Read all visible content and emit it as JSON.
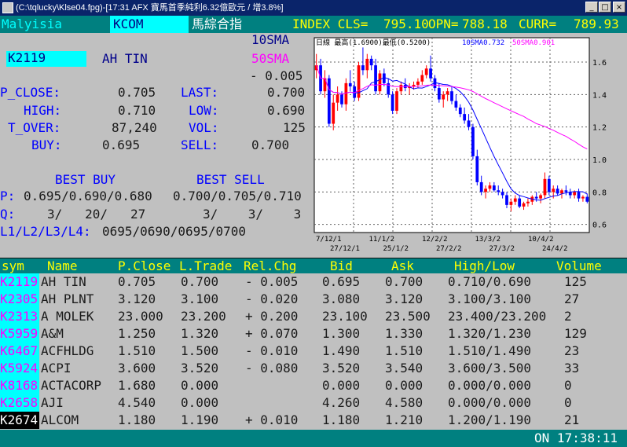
{
  "window": {
    "title": "(C:\\tqlucky\\Klse04.fpg)-[17:31 AFX  寶馬首季純利6.32億歐元 / 增3.8%]",
    "buttons": [
      "_",
      "□",
      "×"
    ]
  },
  "header": {
    "market": "Malyisia",
    "code": "KCOM",
    "index_name": "馬綜合指",
    "index_cls_label": "INDEX CLS=",
    "index_cls": "795.10",
    "opn_label": "OPN=",
    "opn": "788.18",
    "curr_label": "CURR=",
    "curr": "789.93"
  },
  "quote": {
    "sma10_label": "10SMA",
    "code": "K2119",
    "name": "AH TIN",
    "sma50_label": "50SMA",
    "change": "- 0.005",
    "p_close_label": "P_CLOSE:",
    "p_close": "0.705",
    "last_label": "LAST:",
    "last": "0.700",
    "high_label": "HIGH:",
    "high": "0.710",
    "low_label": "LOW:",
    "low": "0.690",
    "t_over_label": "T_OVER:",
    "t_over": "87,240",
    "vol_label": "VOL:",
    "vol": "125",
    "buy_label": "BUY:",
    "buy": "0.695",
    "sell_label": "SELL:",
    "sell": "0.700",
    "best_buy_label": "BEST BUY",
    "best_sell_label": "BEST SELL",
    "p_label": "P:",
    "best_buy_prices": "0.695/0.690/0.680",
    "best_sell_prices": "0.700/0.705/0.710",
    "q_label": "Q:",
    "best_buy_qty": "3/   20/   27",
    "best_sell_qty": "3/    3/    3",
    "levels_label": "L1/L2/L3/L4:",
    "levels": "0695/0690/0695/0700"
  },
  "chart_data": {
    "type": "candlestick",
    "legend_text": "日線 最高(1.6900)最低(0.5200)",
    "sma10_text": "10SMA0.732",
    "sma50_text": "50SMA0.901",
    "ylim": [
      0.55,
      1.75
    ],
    "y_ticks": [
      "1.6",
      "1.4",
      "1.2",
      "1.0",
      "0.8",
      "0.6"
    ],
    "y_tick_values": [
      1.6,
      1.4,
      1.2,
      1.0,
      0.8,
      0.6
    ],
    "x_labels_top": [
      "7/12/1",
      "11/1/2",
      "12/2/2",
      "13/3/2",
      "10/4/2"
    ],
    "x_labels_bottom": [
      "27/12/1",
      "25/1/2",
      "27/2/2",
      "27/3/2",
      "24/4/2"
    ],
    "grid": true,
    "candles": [
      [
        1.55,
        1.65,
        1.5,
        1.58
      ],
      [
        1.58,
        1.62,
        1.4,
        1.42
      ],
      [
        1.42,
        1.55,
        1.38,
        1.5
      ],
      [
        1.5,
        1.52,
        1.2,
        1.22
      ],
      [
        1.22,
        1.4,
        1.18,
        1.35
      ],
      [
        1.35,
        1.45,
        1.3,
        1.4
      ],
      [
        1.4,
        1.42,
        1.32,
        1.34
      ],
      [
        1.34,
        1.5,
        1.3,
        1.47
      ],
      [
        1.47,
        1.55,
        1.42,
        1.45
      ],
      [
        1.45,
        1.48,
        1.36,
        1.38
      ],
      [
        1.38,
        1.6,
        1.36,
        1.58
      ],
      [
        1.58,
        1.69,
        1.52,
        1.55
      ],
      [
        1.55,
        1.65,
        1.5,
        1.62
      ],
      [
        1.62,
        1.64,
        1.55,
        1.58
      ],
      [
        1.58,
        1.62,
        1.4,
        1.42
      ],
      [
        1.42,
        1.55,
        1.4,
        1.53
      ],
      [
        1.53,
        1.56,
        1.45,
        1.47
      ],
      [
        1.47,
        1.5,
        1.38,
        1.4
      ],
      [
        1.4,
        1.42,
        1.28,
        1.3
      ],
      [
        1.3,
        1.44,
        1.28,
        1.42
      ],
      [
        1.42,
        1.48,
        1.4,
        1.46
      ],
      [
        1.46,
        1.5,
        1.42,
        1.44
      ],
      [
        1.44,
        1.47,
        1.4,
        1.45
      ],
      [
        1.45,
        1.48,
        1.43,
        1.46
      ],
      [
        1.46,
        1.5,
        1.44,
        1.48
      ],
      [
        1.48,
        1.55,
        1.46,
        1.52
      ],
      [
        1.52,
        1.58,
        1.5,
        1.56
      ],
      [
        1.56,
        1.64,
        1.48,
        1.5
      ],
      [
        1.5,
        1.52,
        1.42,
        1.44
      ],
      [
        1.44,
        1.47,
        1.35,
        1.37
      ],
      [
        1.37,
        1.42,
        1.32,
        1.4
      ],
      [
        1.4,
        1.44,
        1.36,
        1.42
      ],
      [
        1.42,
        1.45,
        1.34,
        1.36
      ],
      [
        1.36,
        1.4,
        1.3,
        1.32
      ],
      [
        1.32,
        1.34,
        1.26,
        1.28
      ],
      [
        1.28,
        1.32,
        1.22,
        1.24
      ],
      [
        1.24,
        1.28,
        1.18,
        1.2
      ],
      [
        1.2,
        1.22,
        1.0,
        1.02
      ],
      [
        1.02,
        1.06,
        0.84,
        0.86
      ],
      [
        0.86,
        0.9,
        0.78,
        0.8
      ],
      [
        0.8,
        0.84,
        0.76,
        0.82
      ],
      [
        0.82,
        0.86,
        0.8,
        0.84
      ],
      [
        0.84,
        0.86,
        0.8,
        0.81
      ],
      [
        0.81,
        0.84,
        0.78,
        0.8
      ],
      [
        0.8,
        0.82,
        0.76,
        0.78
      ],
      [
        0.78,
        0.8,
        0.7,
        0.72
      ],
      [
        0.72,
        0.76,
        0.68,
        0.74
      ],
      [
        0.74,
        0.78,
        0.72,
        0.76
      ],
      [
        0.76,
        0.78,
        0.7,
        0.71
      ],
      [
        0.71,
        0.74,
        0.69,
        0.73
      ],
      [
        0.73,
        0.76,
        0.71,
        0.74
      ],
      [
        0.74,
        0.78,
        0.72,
        0.77
      ],
      [
        0.77,
        0.8,
        0.74,
        0.76
      ],
      [
        0.76,
        0.79,
        0.73,
        0.78
      ],
      [
        0.78,
        0.92,
        0.76,
        0.88
      ],
      [
        0.88,
        0.9,
        0.78,
        0.8
      ],
      [
        0.8,
        0.84,
        0.76,
        0.82
      ],
      [
        0.82,
        0.84,
        0.78,
        0.79
      ],
      [
        0.79,
        0.82,
        0.76,
        0.81
      ],
      [
        0.81,
        0.84,
        0.78,
        0.8
      ],
      [
        0.8,
        0.82,
        0.76,
        0.78
      ],
      [
        0.78,
        0.81,
        0.76,
        0.8
      ],
      [
        0.8,
        0.82,
        0.74,
        0.76
      ],
      [
        0.76,
        0.78,
        0.74,
        0.77
      ],
      [
        0.77,
        0.79,
        0.73,
        0.74
      ]
    ],
    "colors": {
      "up": "#ff0000",
      "down": "#0000ff",
      "sma10": "#0000ff",
      "sma50": "#ff00ff",
      "grid": "#606060",
      "bg": "#ffffff"
    }
  },
  "table": {
    "headers": {
      "sym": "sym",
      "name": "Name",
      "pclose": "P.Close",
      "ltrade": "L.Trade",
      "relchg": "Rel.Chg",
      "bid": "Bid",
      "ask": "Ask",
      "highlow": "High/Low",
      "volume": "Volume"
    },
    "rows": [
      {
        "sym": "K2119",
        "name": "AH TIN",
        "pclose": "0.705",
        "ltrade": "0.700",
        "relchg": "- 0.005",
        "bid": "0.695",
        "ask": "0.700",
        "highlow": "0.710/0.690",
        "volume": "125"
      },
      {
        "sym": "K2305",
        "name": "AH PLNT",
        "pclose": "3.120",
        "ltrade": "3.100",
        "relchg": "- 0.020",
        "bid": "3.080",
        "ask": "3.120",
        "highlow": "3.100/3.100",
        "volume": "27"
      },
      {
        "sym": "K2313",
        "name": "A MOLEK",
        "pclose": "23.000",
        "ltrade": "23.200",
        "relchg": "+ 0.200",
        "bid": "23.100",
        "ask": "23.500",
        "highlow": "23.400/23.200",
        "volume": "2"
      },
      {
        "sym": "K5959",
        "name": "A&M",
        "pclose": "1.250",
        "ltrade": "1.320",
        "relchg": "+ 0.070",
        "bid": "1.300",
        "ask": "1.330",
        "highlow": "1.320/1.230",
        "volume": "129"
      },
      {
        "sym": "K6467",
        "name": "ACFHLDG",
        "pclose": "1.510",
        "ltrade": "1.500",
        "relchg": "- 0.010",
        "bid": "1.490",
        "ask": "1.510",
        "highlow": "1.510/1.490",
        "volume": "23"
      },
      {
        "sym": "K5924",
        "name": "ACPI",
        "pclose": "3.600",
        "ltrade": "3.520",
        "relchg": "- 0.080",
        "bid": "3.520",
        "ask": "3.540",
        "highlow": "3.600/3.500",
        "volume": "33"
      },
      {
        "sym": "K8168",
        "name": "ACTACORP",
        "pclose": "1.680",
        "ltrade": "0.000",
        "relchg": "",
        "bid": "0.000",
        "ask": "0.000",
        "highlow": "0.000/0.000",
        "volume": "0"
      },
      {
        "sym": "K2658",
        "name": "AJI",
        "pclose": "4.540",
        "ltrade": "0.000",
        "relchg": "",
        "bid": "4.260",
        "ask": "4.580",
        "highlow": "0.000/0.000",
        "volume": "0"
      },
      {
        "sym": "K2674",
        "name": "ALCOM",
        "pclose": "1.180",
        "ltrade": "1.190",
        "relchg": "+ 0.010",
        "bid": "1.180",
        "ask": "1.210",
        "highlow": "1.200/1.190",
        "volume": "21"
      }
    ],
    "selected_index": 8
  },
  "status": {
    "time": "ON 17:38:11"
  }
}
